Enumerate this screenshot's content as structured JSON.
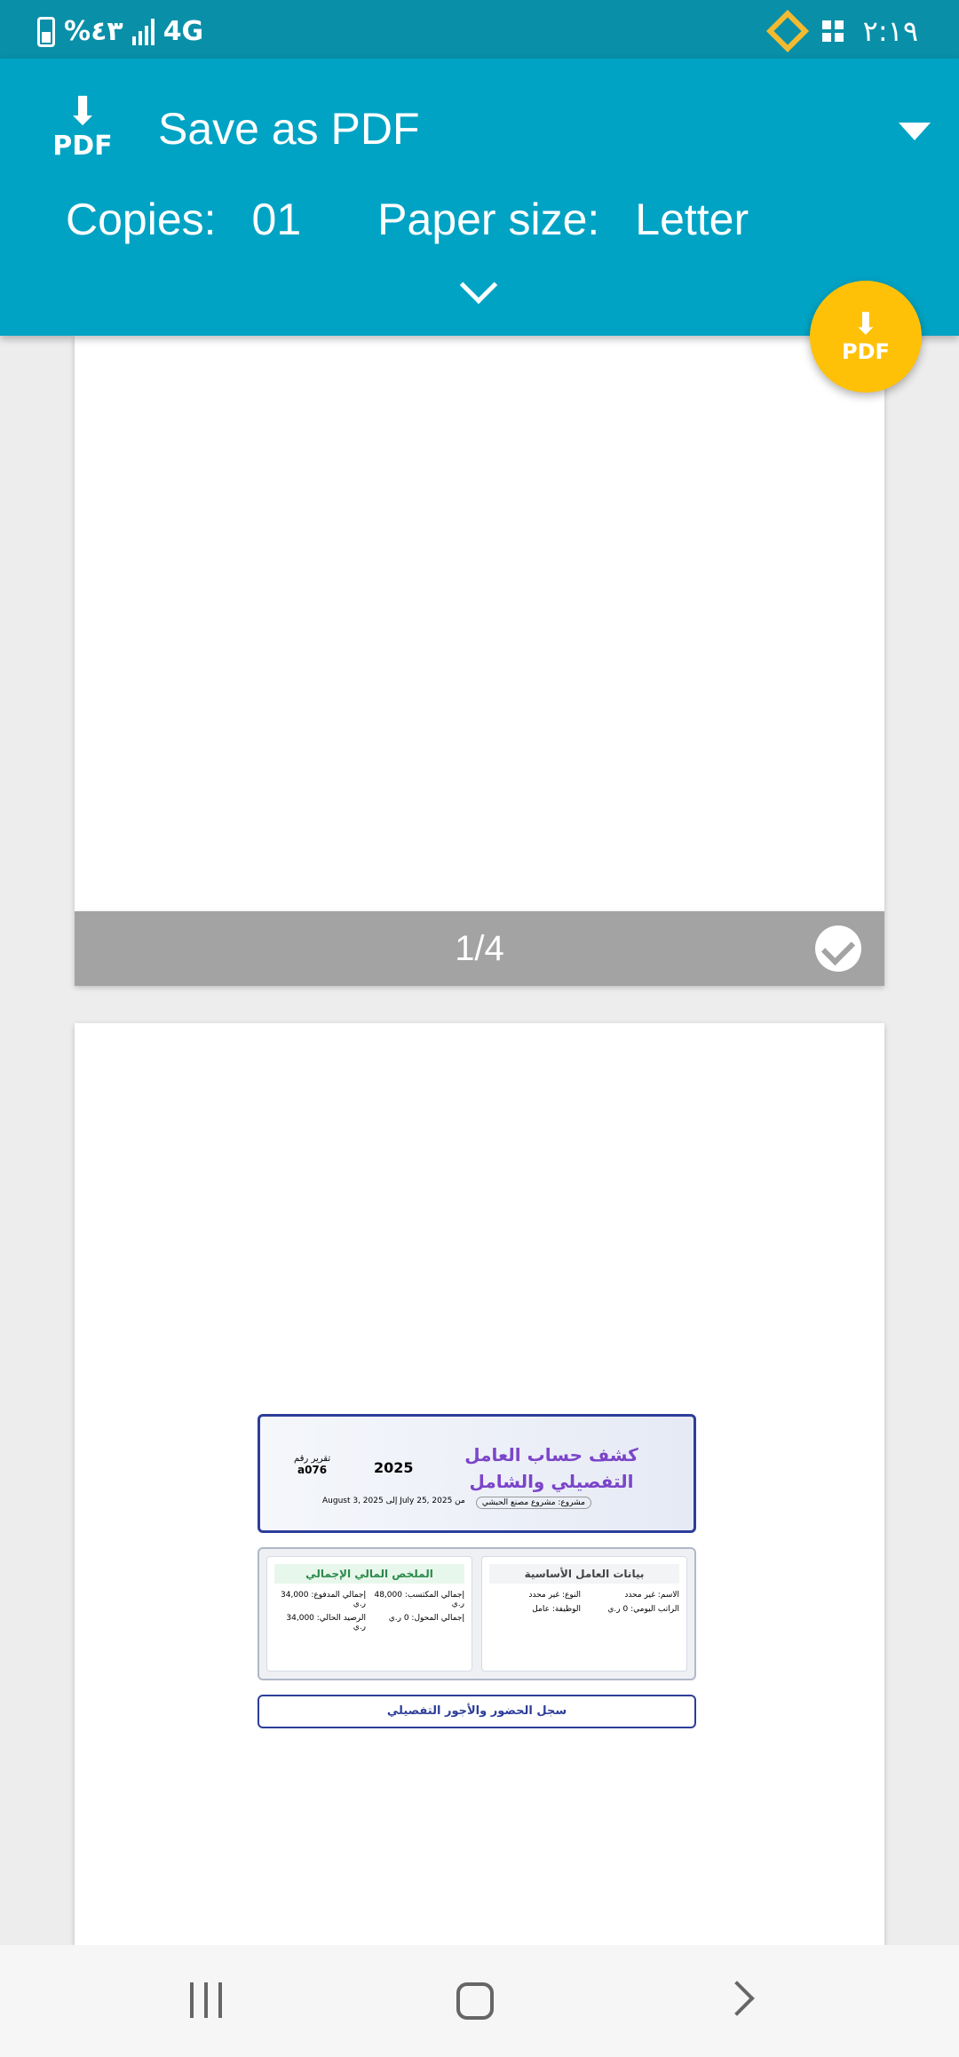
{
  "status_bar": {
    "battery_text": "%٤٣",
    "network": "4G",
    "time": "٢:١٩"
  },
  "header": {
    "pdf_icon_label": "PDF",
    "destination": "Save as PDF",
    "copies_label": "Copies:",
    "copies_value": "01",
    "paper_size_label": "Paper size:",
    "paper_size_value": "Letter"
  },
  "fab": {
    "label": "PDF"
  },
  "page1": {
    "indicator": "1/4"
  },
  "report": {
    "title": "كشف حساب العامل التفصيلي والشامل",
    "year": "2025",
    "report_no_label": "تقرير رقم",
    "report_no": "a076",
    "project": "مشروع: مشروع مصنع الحبشي",
    "date_range": "من July 25, 2025 إلى August 3, 2025",
    "basic_info": {
      "title": "بيانات العامل الأساسية",
      "name": "الاسم: غير محدد",
      "type": "النوع: غير محدد",
      "daily_wage": "الراتب اليومي: 0 ر.ي",
      "job": "الوظيفة: عامل"
    },
    "financial_summary": {
      "title": "الملخص المالي الإجمالي",
      "total_earned": "إجمالي المكتسب: 48,000 ر.ي",
      "total_paid": "إجمالي المدفوع: 34,000 ر.ي",
      "total_transferred": "إجمالي المحول: 0 ر.ي",
      "current_balance": "الرصيد الحالي: 34,000 ر.ي"
    },
    "attendance_title": "سجل الحضور والأجور التفصيلي"
  }
}
